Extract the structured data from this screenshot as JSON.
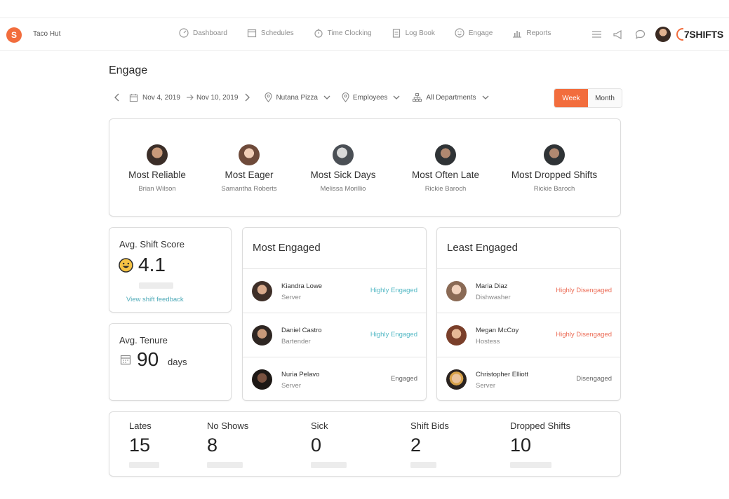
{
  "header": {
    "brand": "Taco Hut",
    "nav": [
      {
        "label": "Dashboard",
        "icon": "gauge-icon"
      },
      {
        "label": "Schedules",
        "icon": "calendar-icon"
      },
      {
        "label": "Time Clocking",
        "icon": "stopwatch-icon"
      },
      {
        "label": "Log Book",
        "icon": "clipboard-icon"
      },
      {
        "label": "Engage",
        "icon": "smile-icon"
      },
      {
        "label": "Reports",
        "icon": "bar-chart-icon"
      }
    ],
    "logo_text": "7SHIFTS"
  },
  "page": {
    "title": "Engage"
  },
  "filters": {
    "start_date": "Nov 4, 2019",
    "end_date": "Nov 10, 2019",
    "location": "Nutana Pizza",
    "employees": "Employees",
    "departments": "All Departments",
    "period_options": [
      "Week",
      "Month"
    ],
    "selected_period": "Week"
  },
  "awards": [
    {
      "title": "Most Reliable",
      "name": "Brian Wilson"
    },
    {
      "title": "Most Eager",
      "name": "Samantha Roberts"
    },
    {
      "title": "Most Sick Days",
      "name": "Melissa Morillio"
    },
    {
      "title": "Most Often Late",
      "name": "Rickie Baroch"
    },
    {
      "title": "Most Dropped Shifts",
      "name": "Rickie Baroch"
    }
  ],
  "shift_score": {
    "label": "Avg. Shift Score",
    "value": "4.1",
    "link": "View shift feedback"
  },
  "tenure": {
    "label": "Avg. Tenure",
    "value": "90",
    "unit": "days"
  },
  "most_engaged": {
    "title": "Most Engaged",
    "rows": [
      {
        "name": "Kiandra Lowe",
        "role": "Server",
        "status": "Highly Engaged"
      },
      {
        "name": "Daniel Castro",
        "role": "Bartender",
        "status": "Highly Engaged"
      },
      {
        "name": "Nuria Pelavo",
        "role": "Server",
        "status": "Engaged"
      }
    ]
  },
  "least_engaged": {
    "title": "Least Engaged",
    "rows": [
      {
        "name": "Maria Diaz",
        "role": "Dishwasher",
        "status": "Highly Disengaged"
      },
      {
        "name": "Megan McCoy",
        "role": "Hostess",
        "status": "Highly Disengaged"
      },
      {
        "name": "Christopher Elliott",
        "role": "Server",
        "status": "Disengaged"
      }
    ]
  },
  "stats": [
    {
      "label": "Lates",
      "value": "15"
    },
    {
      "label": "No Shows",
      "value": "8"
    },
    {
      "label": "Sick",
      "value": "0"
    },
    {
      "label": "Shift Bids",
      "value": "2"
    },
    {
      "label": "Dropped Shifts",
      "value": "10"
    }
  ],
  "colors": {
    "accent": "#f26d3d",
    "engaged": "#52b8c4",
    "disengaged": "#ec6c56"
  }
}
